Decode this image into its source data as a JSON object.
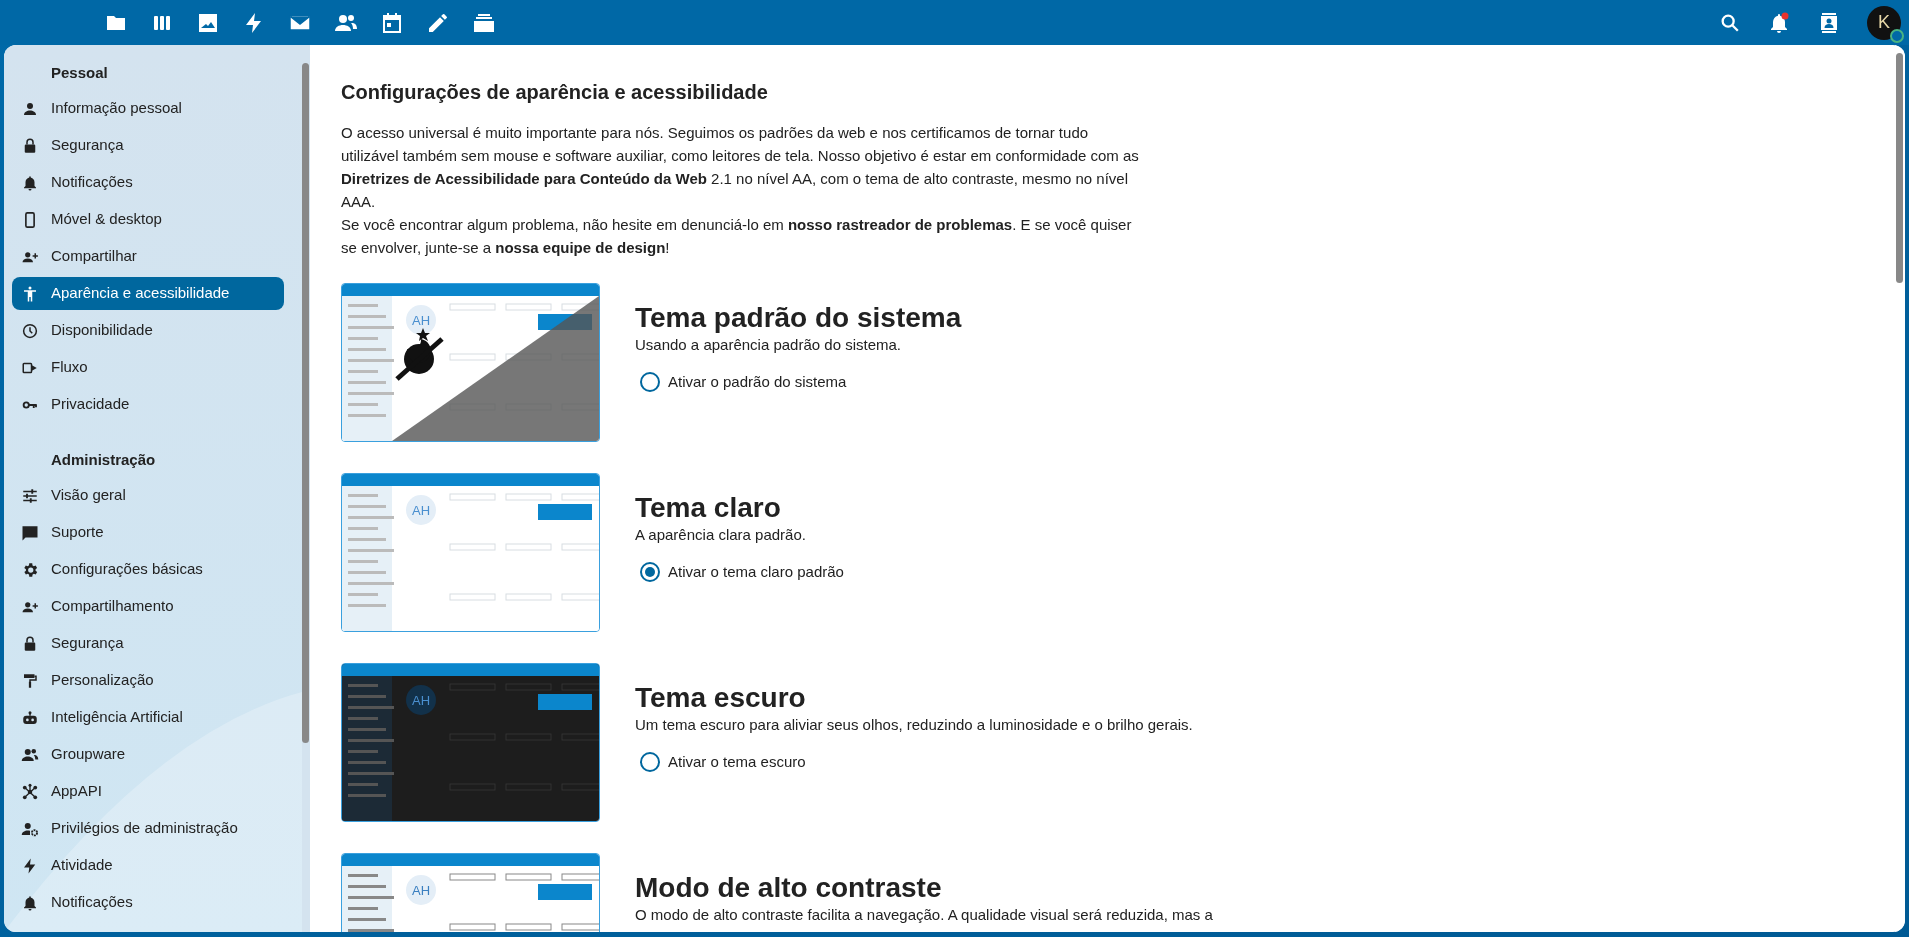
{
  "header": {
    "notifications": {
      "unread": true
    },
    "avatar": {
      "initial": "K",
      "online": true
    }
  },
  "sidebar": {
    "sections": [
      {
        "title": "Pessoal",
        "items": [
          {
            "label": "Informação pessoal",
            "kind": "person",
            "selected": false
          },
          {
            "label": "Segurança",
            "kind": "lock",
            "selected": false
          },
          {
            "label": "Notificações",
            "kind": "bell",
            "selected": false
          },
          {
            "label": "Móvel & desktop",
            "kind": "phone",
            "selected": false
          },
          {
            "label": "Compartilhar",
            "kind": "share",
            "selected": false
          },
          {
            "label": "Aparência e acessibilidade",
            "kind": "accessibility",
            "selected": true
          },
          {
            "label": "Disponibilidade",
            "kind": "clock",
            "selected": false
          },
          {
            "label": "Fluxo",
            "kind": "flow",
            "selected": false
          },
          {
            "label": "Privacidade",
            "kind": "key",
            "selected": false
          }
        ]
      },
      {
        "title": "Administração",
        "items": [
          {
            "label": "Visão geral",
            "kind": "sliders",
            "selected": false
          },
          {
            "label": "Suporte",
            "kind": "chat",
            "selected": false
          },
          {
            "label": "Configurações básicas",
            "kind": "gear",
            "selected": false
          },
          {
            "label": "Compartilhamento",
            "kind": "share",
            "selected": false
          },
          {
            "label": "Segurança",
            "kind": "lock",
            "selected": false
          },
          {
            "label": "Personalização",
            "kind": "roller",
            "selected": false
          },
          {
            "label": "Inteligência Artificial",
            "kind": "robot",
            "selected": false
          },
          {
            "label": "Groupware",
            "kind": "group",
            "selected": false
          },
          {
            "label": "AppAPI",
            "kind": "network",
            "selected": false
          },
          {
            "label": "Privilégios de administração",
            "kind": "admin",
            "selected": false
          },
          {
            "label": "Atividade",
            "kind": "bolt",
            "selected": false
          },
          {
            "label": "Notificações",
            "kind": "bell",
            "selected": false
          }
        ]
      }
    ]
  },
  "content": {
    "title": "Configurações de aparência e acessibilidade",
    "paragraphs": [
      "O acesso universal é muito importante para nós. Seguimos os padrões da web e nos certificamos de tornar tudo utilizável também sem mouse e software auxiliar, como leitores de tela. Nosso objetivo é estar em conformidade com as **Diretrizes de Acessibilidade para Conteúdo da Web** 2.1 no nível AA, com o tema de alto contraste, mesmo no nível AAA.",
      "Se você encontrar algum problema, não hesite em denunciá-lo em **nosso rastreador de problemas**. E se você quiser se envolver, junte-se a **nossa equipe de design**!"
    ],
    "themes": [
      {
        "kind": "system",
        "preview_initials": "AH",
        "title": "Tema padrão do sistema",
        "description": "Usando a aparência padrão do sistema.",
        "option": "Ativar o padrão do sistema",
        "selected": false
      },
      {
        "kind": "light",
        "preview_initials": "AH",
        "title": "Tema claro",
        "description": "A aparência clara padrão.",
        "option": "Ativar o tema claro padrão",
        "selected": true
      },
      {
        "kind": "dark",
        "preview_initials": "AH",
        "title": "Tema escuro",
        "description": "Um tema escuro para aliviar seus olhos, reduzindo a luminosidade e o brilho gerais.",
        "option": "Ativar o tema escuro",
        "selected": false
      },
      {
        "kind": "contrast",
        "preview_initials": "AH",
        "title": "Modo de alto contraste",
        "description": "O modo de alto contraste facilita a navegação. A qualidade visual será reduzida, mas a"
      }
    ]
  }
}
